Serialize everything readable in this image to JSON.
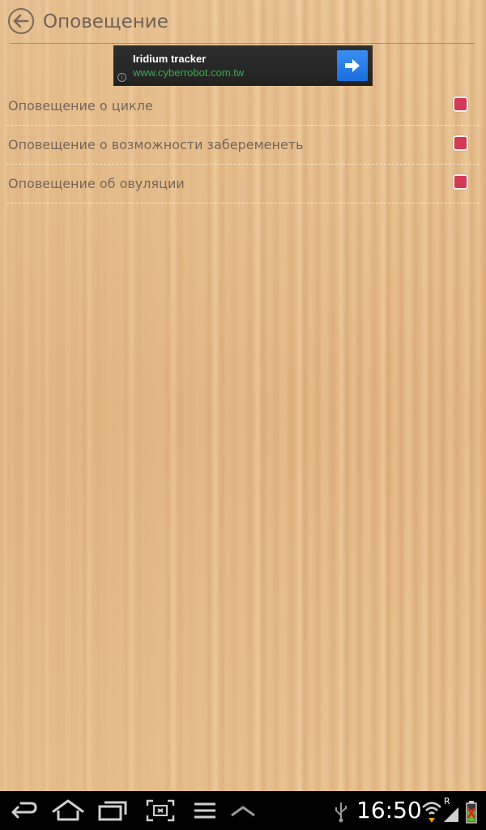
{
  "header": {
    "title": "Оповещение",
    "back_icon": "back-arrow-circle-icon"
  },
  "ad": {
    "title": "Iridium tracker",
    "url": "www.cyberrobot.com.tw",
    "arrow_icon": "arrow-right-icon",
    "info_icon": "info-icon",
    "info_glyph": "i"
  },
  "settings": {
    "items": [
      {
        "label": "Оповещение о цикле",
        "checked": true
      },
      {
        "label": "Оповещение о возможности забеременеть",
        "checked": true
      },
      {
        "label": "Оповещение об овуляции",
        "checked": true
      }
    ],
    "check_color": "#d33a55"
  },
  "navbar": {
    "buttons": [
      "back-icon",
      "home-icon",
      "recent-apps-icon",
      "screenshot-icon",
      "menu-icon",
      "up-chevron-icon"
    ],
    "status_icons": [
      "usb-icon",
      "wifi-icon",
      "signal-icon",
      "battery-icon"
    ],
    "signal_label": "R",
    "time": "16:50"
  }
}
